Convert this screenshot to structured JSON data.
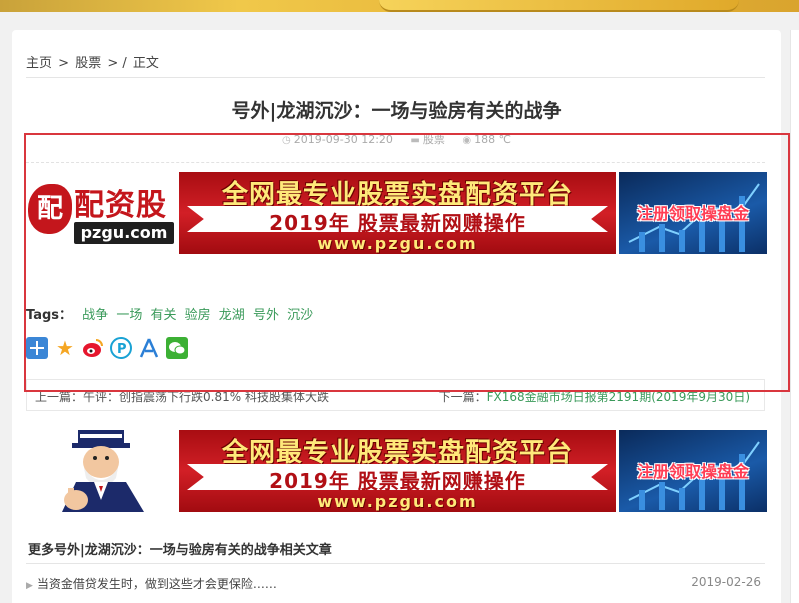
{
  "breadcrumb": {
    "home": "主页",
    "sep1": ">",
    "category": "股票",
    "sep2": "> /",
    "current": "正文"
  },
  "article": {
    "title": "号外|龙湖沉沙：一场与验房有关的战争",
    "date": "2019-09-30 12:20",
    "category": "股票",
    "views": "188 ℃"
  },
  "ad_banner": {
    "logo_cn": "配资股",
    "logo_seal": "配",
    "logo_url": "pzgu.com",
    "headline": "全网最专业股票实盘配资平台",
    "subline": "2019年 股票最新网赚操作",
    "url": "www.pzgu.com",
    "cta": "注册领取操盘金"
  },
  "tags": {
    "label": "Tags：",
    "items": [
      "战争",
      "一场",
      "有关",
      "验房",
      "龙湖",
      "号外",
      "沉沙"
    ]
  },
  "share": {
    "buttons": [
      {
        "icon": "plus-share-icon",
        "color": "#3b86d6",
        "glyph": "+"
      },
      {
        "icon": "star-favorite-icon",
        "color": "#f5a623",
        "glyph": "★"
      },
      {
        "icon": "weibo-icon",
        "color": "#e6162d",
        "glyph": "W"
      },
      {
        "icon": "pinterest-icon",
        "color": "#19a2d4",
        "glyph": "P"
      },
      {
        "icon": "people-icon",
        "color": "#2b7fd6",
        "glyph": "人"
      },
      {
        "icon": "wechat-icon",
        "color": "#3cb034",
        "glyph": "✉"
      }
    ]
  },
  "navigation": {
    "prev_label": "上一篇：",
    "prev_title": "午评：创指震荡下行跌0.81% 科技股集体大跌",
    "next_label": "下一篇：",
    "next_title": "FX168金融市场日报第2191期(2019年9月30日)"
  },
  "related": {
    "heading": "更多号外|龙湖沉沙：一场与验房有关的战争相关文章",
    "items": [
      {
        "title": "当资金借贷发生时，做到这些才会更保险……",
        "date": "2019-02-26"
      }
    ]
  },
  "colors": {
    "accent_green": "#3a9a5a",
    "highlight_red": "#d9363e",
    "ad_red": "#c4161c"
  }
}
